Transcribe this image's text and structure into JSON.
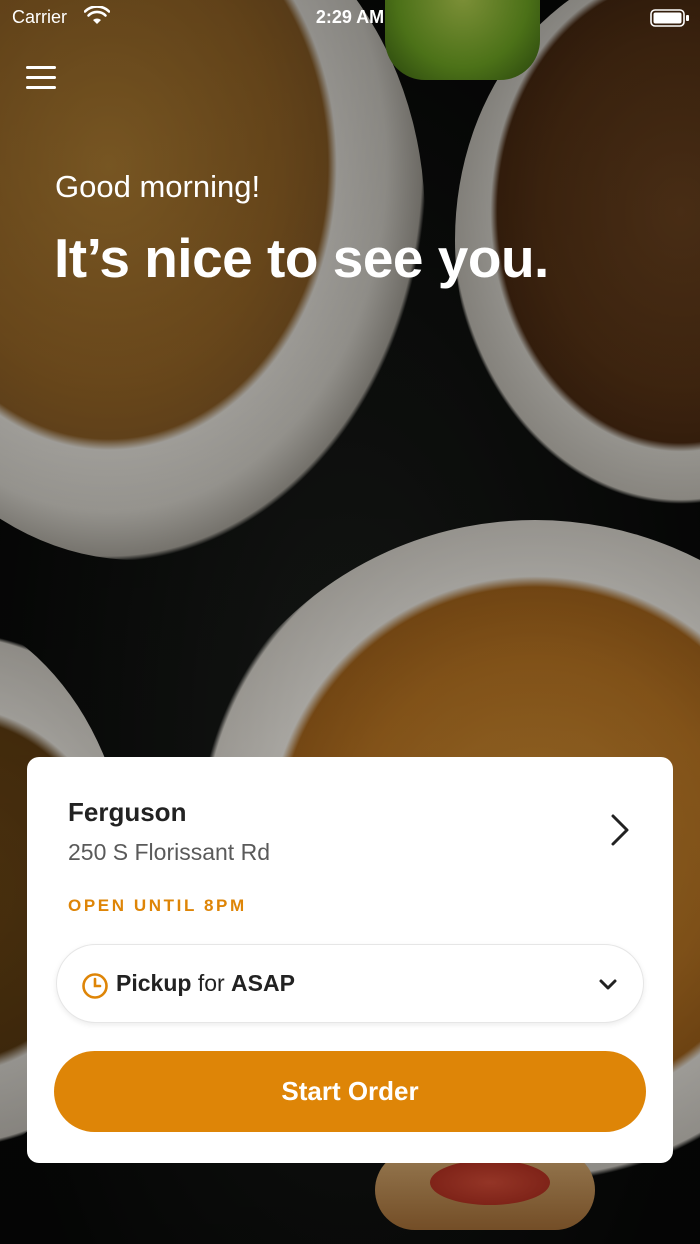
{
  "status_bar": {
    "carrier": "Carrier",
    "time": "2:29 AM"
  },
  "hero": {
    "greeting": "Good morning!",
    "headline": "It’s nice to see you."
  },
  "location": {
    "name": "Ferguson",
    "address": "250 S Florissant Rd",
    "status": "OPEN UNTIL 8PM"
  },
  "order_type": {
    "mode": "Pickup",
    "connector": "for",
    "time": "ASAP"
  },
  "actions": {
    "start_order": "Start Order"
  },
  "colors": {
    "accent": "#de8507"
  },
  "icons": [
    "menu-icon",
    "wifi-icon",
    "battery-icon",
    "chevron-right-icon",
    "clock-icon",
    "chevron-down-icon"
  ]
}
